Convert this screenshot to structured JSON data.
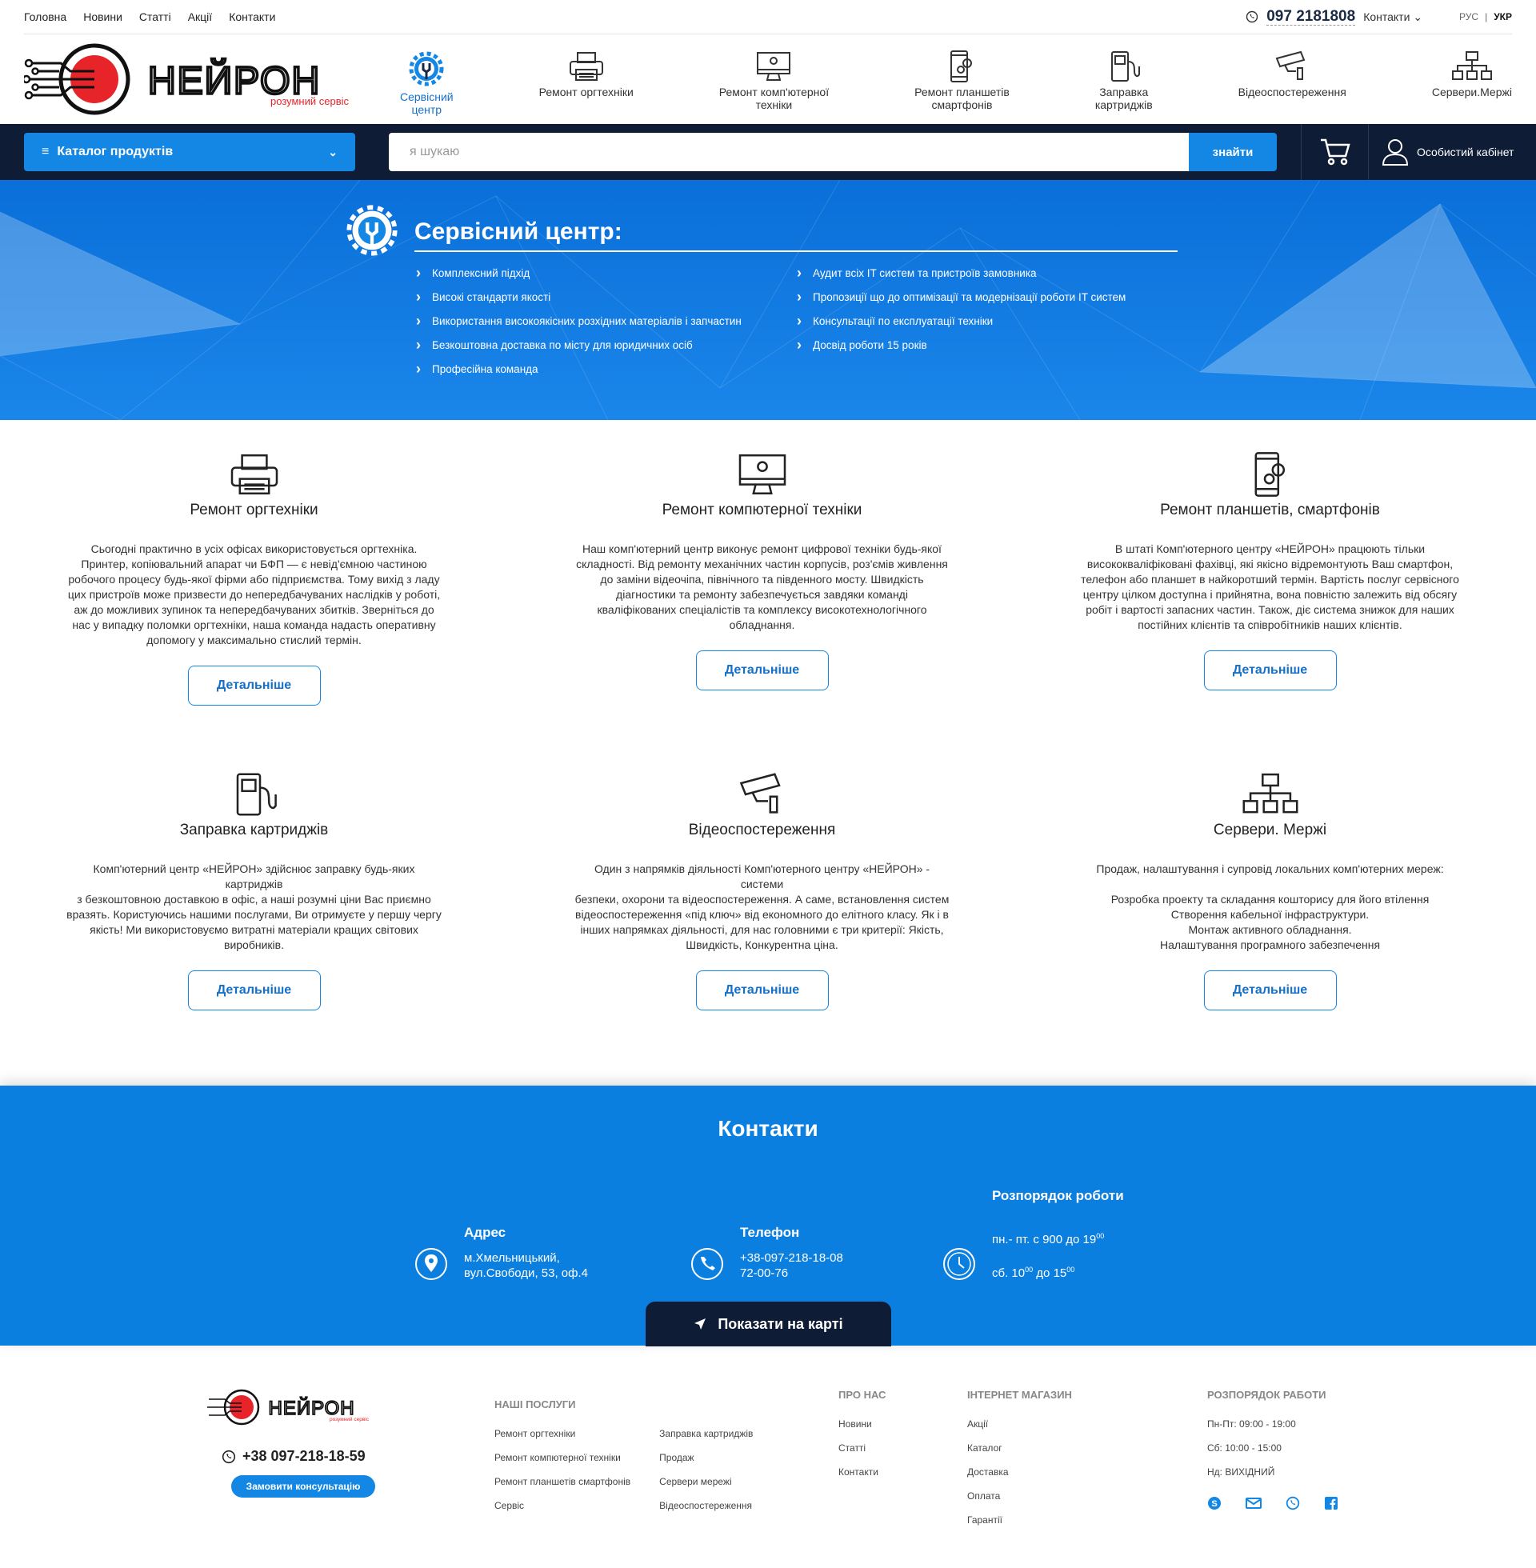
{
  "topnav": [
    "Головна",
    "Новини",
    "Статті",
    "Акції",
    "Контакти"
  ],
  "top": {
    "phone": "097 2181808",
    "contacts": "Контакти",
    "lang_ru": "РУС",
    "lang_sep": "|",
    "lang_ua": "УКР"
  },
  "logo": {
    "brand": "НЕЙРОН",
    "tagline": "розумний сервіс"
  },
  "catnav": [
    {
      "label": "Сервісний\nцентр",
      "icon": "gear-wrench-icon"
    },
    {
      "label": "Ремонт оргтехніки",
      "icon": "printer-icon"
    },
    {
      "label": "Ремонт комп'ютерної\nтехніки",
      "icon": "monitor-icon"
    },
    {
      "label": "Ремонт  планшетів\nсмартфонів",
      "icon": "phone-gear-icon"
    },
    {
      "label": "Заправка\nкартриджів",
      "icon": "fuel-icon"
    },
    {
      "label": "Відеоспостереження",
      "icon": "camera-icon"
    },
    {
      "label": "Сервери.Мержі",
      "icon": "network-icon"
    }
  ],
  "searchbar": {
    "catalog": "Каталог продуктів",
    "placeholder": "я шукаю",
    "button": "знайти",
    "cabinet": "Особистий кабінет"
  },
  "hero": {
    "title": "Сервісний центр:",
    "left": [
      "Комплексний підхід",
      "Високі стандарти якості",
      "Використання високоякісних розхідних матеріалів і запчастин",
      "Безкоштовна доставка по місту для юридичних осіб",
      "Професійна команда"
    ],
    "right": [
      "Аудит всіх IT систем та пристроїв замовника",
      "Пропозиції що до оптимізації та модернізації роботи IT систем",
      "Консультації по експлуатації техніки",
      "Досвід роботи 15 років"
    ]
  },
  "services": [
    {
      "title": "Ремонт оргтехніки",
      "icon": "printer-icon",
      "text": "Сьогодні практично в усіх офісах використовується оргтехніка.\nПринтер, копіювальний апарат чи БФП — є невід'ємною частиною\nробочого процесу будь-якої фірми або підприємства. Тому вихід з ладу\nцих пристроїв може призвести до непередбачуваних наслідків у роботі,\nаж до можливих зупинок та непередбачуваних збитків. Зверніться до\nнас у випадку поломки оргтехніки, наша команда надасть оперативну\nдопомогу у максимально стислий термін.",
      "more": "Детальніше"
    },
    {
      "title": "Ремонт компютерної техніки",
      "icon": "monitor-icon",
      "text": "Наш комп'ютерний центр  виконує ремонт цифрової техніки будь-якої\nскладності. Від ремонту механічних частин корпусів, роз'ємів живлення\nдо заміни відеочіпа,  північного та південного мосту. Швидкість\nдіагностики та ремонту  забезпечується завдяки команді\nкваліфікованих спеціалістів та комплексу  високотехнологічного\nобладнання.",
      "more": "Детальніше"
    },
    {
      "title": "Ремонт  планшетів, смартфонів",
      "icon": "phone-gear-icon",
      "text": "В штаті Комп'ютерного центру «НЕЙРОН» працюють тільки\nвисококваліфіковані фахівці, які якісно відремонтують Ваш смартфон,\nтелефон або планшет в найкоротший термін. Вартість послуг  сервісного\nцентру цілком доступна і прийнятна, вона повністю залежить  від обсягу\nробіт і вартості запасних частин. Також, діє система знижок для наших\nпостійних клієнтів та співробітників наших клієнтів.",
      "more": "Детальніше"
    },
    {
      "title": "Заправка картриджів",
      "icon": "fuel-icon",
      "text": "Комп'ютерний центр «НЕЙРОН» здійснює заправку будь-яких картриджів\nз безкоштовною доставкою в офіс, а наші розумні ціни Вас приємно\nвразять. Користуючись нашими послугами, Ви отримуєте у першу чергу\nякість! Ми використовуємо витратні матеріали кращих світових\nвиробників.",
      "more": "Детальніше"
    },
    {
      "title": "Відеоспостереження",
      "icon": "camera-icon",
      "text": "Один з напрямків діяльності Комп'ютерного центру «НЕЙРОН» - системи\nбезпеки, охорони та відеоспостереження. А саме, встановлення систем\nвідеоспостереження «під ключ» від економного до елітного класу. Як і в\nінших напрямках діяльності, для нас головними є три критерії: Якість,\nШвидкість, Конкурентна ціна.",
      "more": "Детальніше"
    },
    {
      "title": "Сервери. Мержі",
      "icon": "network-icon",
      "text": "Продаж, налаштування і супровід локальних комп'ютерних мереж:\n\nРозробка проекту та складання кошторису для його втілення\nСтворення кабельної інфраструктури.\nМонтаж активного обладнання.\nНалаштування програмного забезпечення",
      "more": "Детальніше"
    }
  ],
  "contacts": {
    "title": "Контакти",
    "address_h": "Адрес",
    "address": "м.Хмельницький,\nвул.Свободи, 53, оф.4",
    "phone_h": "Телефон",
    "phone": "+38-097-218-18-08\n 72-00-76",
    "hours_h": "Розпорядок роботи",
    "hours1_a": "пн.- пт. с 900 до 19",
    "hours1_sup": "00",
    "hours2_a": "сб. 10",
    "hours2_sup1": "00",
    "hours2_b": " до 15",
    "hours2_sup2": "00",
    "map": "Показати на карті"
  },
  "footer": {
    "phone": "+38 097-218-18-59",
    "consult": "Замовити консультацію",
    "services_h": "НАШІ ПОСЛУГИ",
    "services1": [
      "Ремонт оргтехніки",
      "Ремонт компютерної техніки",
      "Ремонт планшетів смартфонів",
      "Сервіс"
    ],
    "services2": [
      "Заправка картриджів",
      "Продаж",
      "Сервери мережі",
      "Відеоспостереження"
    ],
    "about_h": "ПРО НАС",
    "about": [
      "Новини",
      "Статті",
      "Контакти"
    ],
    "shop_h": "ІНТЕРНЕТ МАГАЗИН",
    "shop": [
      "Акції",
      "Каталог",
      "Доставка",
      "Оплата",
      "Гарантії"
    ],
    "hours_h": "РОЗПОРЯДОК РАБОТИ",
    "hours": [
      "Пн-Пт: 09:00 - 19:00",
      "Сб: 10:00 - 15:00",
      "Нд: ВИХІДНИЙ"
    ],
    "socials": [
      "skype-icon",
      "mail-icon",
      "viber-icon",
      "facebook-icon"
    ]
  },
  "colors": {
    "accent": "#1487e5",
    "dark": "#0f1c35",
    "logo_red": "#e8242b"
  }
}
